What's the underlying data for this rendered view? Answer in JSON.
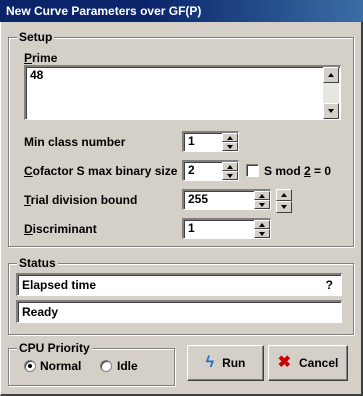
{
  "window": {
    "title": "New Curve Parameters over GF(P)"
  },
  "setup": {
    "group_title": "Setup",
    "prime": {
      "label": "Prime",
      "value": "48"
    },
    "min_class": {
      "label": "Min class number",
      "value": "1"
    },
    "cofactor": {
      "label": "Cofactor S max binary size",
      "value": "2"
    },
    "smod": {
      "label": "S mod 2 = 0",
      "checked": false
    },
    "trial": {
      "label": "Trial division bound",
      "value": "255"
    },
    "discriminant": {
      "label": "Discriminant",
      "value": "1"
    }
  },
  "status": {
    "group_title": "Status",
    "elapsed_label": "Elapsed time",
    "elapsed_value": "?",
    "state": "Ready"
  },
  "cpu_priority": {
    "group_title": "CPU Priority",
    "options": [
      {
        "label": "Normal",
        "selected": true
      },
      {
        "label": "Idle",
        "selected": false
      }
    ]
  },
  "buttons": {
    "run": "Run",
    "cancel": "Cancel"
  },
  "icons": {
    "run": "lightning-icon",
    "cancel": "red-x-icon"
  },
  "colors": {
    "titlebar": "#0a246a",
    "face": "#d4d0c8",
    "cancel_icon": "#cc0000",
    "run_icon": "#1e6fd0"
  }
}
